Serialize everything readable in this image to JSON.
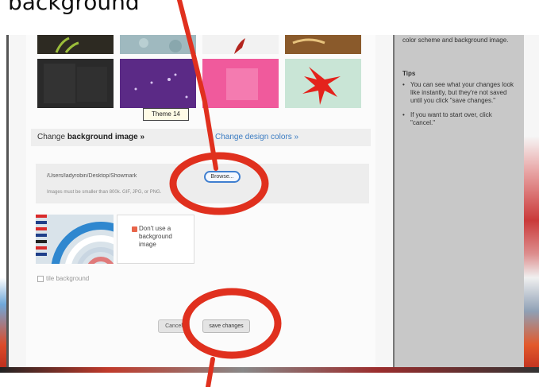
{
  "caption": "background",
  "themes": {
    "tooltip": "Theme 14"
  },
  "background_section": {
    "change_label_prefix": "Change",
    "change_label_bold": "background image »",
    "design_colors_link": "Change design colors »",
    "file_path": "/Users/ladyrobin/Desktop/Showmark",
    "browse_label": "Browse...",
    "upload_hint": "Images must be smaller than 800k. GIF, JPG, or PNG.",
    "no_background_label": "Don't use a background image",
    "tile_label": "tile background"
  },
  "buttons": {
    "cancel": "Cancel",
    "save": "save changes"
  },
  "help": {
    "intro": "color scheme and background image.",
    "tips_title": "Tips",
    "tips": [
      "You can see what your changes look like instantly, but they're not saved until you click \"save changes.\"",
      "If you want to start over, click \"cancel.\""
    ]
  },
  "colors": {
    "annotation_red": "#e0301e",
    "link_blue": "#3b7cc2",
    "sidebar_gray": "#c8c8c8"
  }
}
